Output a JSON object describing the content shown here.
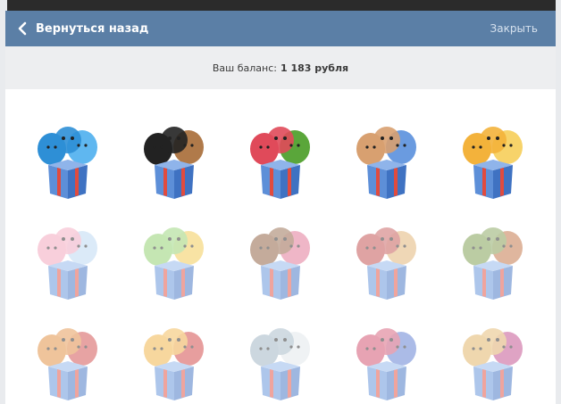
{
  "header": {
    "back_label": "Вернуться назад",
    "close_label": "Закрыть",
    "bg_color": "#5b7fa6"
  },
  "balance": {
    "label": "Ваш баланс:",
    "value": "1 183 рубля"
  },
  "packs": [
    {
      "icon": "blue-dragons-sticker-pack",
      "colors": [
        "#2e8fd6",
        "#5fb7f0"
      ]
    },
    {
      "icon": "rock-band-sticker-pack",
      "colors": [
        "#222222",
        "#b07a4a"
      ]
    },
    {
      "icon": "food-characters-sticker-pack",
      "colors": [
        "#e04a5a",
        "#5aa63a"
      ]
    },
    {
      "icon": "people-thumbs-up-sticker-pack",
      "colors": [
        "#d8a070",
        "#6a9be0"
      ]
    },
    {
      "icon": "sun-star-sticker-pack",
      "colors": [
        "#f3b23b",
        "#f7d36a"
      ]
    },
    {
      "icon": "animals-rainbow-sticker-pack",
      "colors": [
        "#f3a0b8",
        "#b9d6f2"
      ]
    },
    {
      "icon": "cats-collage-sticker-pack",
      "colors": [
        "#8ccf6a",
        "#f2c94c"
      ]
    },
    {
      "icon": "girls-sticker-pack",
      "colors": [
        "#8a5a3a",
        "#e07090"
      ]
    },
    {
      "icon": "mixed-characters-sticker-pack",
      "colors": [
        "#c04a4a",
        "#e0b070"
      ]
    },
    {
      "icon": "kids-goggles-sticker-pack",
      "colors": [
        "#7a9a4a",
        "#c07040"
      ]
    },
    {
      "icon": "cartoon-girl-sticker-pack",
      "colors": [
        "#e08a3a",
        "#d04a4a"
      ]
    },
    {
      "icon": "dog-cat-sticker-pack",
      "colors": [
        "#f0b040",
        "#d04040"
      ]
    },
    {
      "icon": "white-cats-sticker-pack",
      "colors": [
        "#9ab0c0",
        "#e0e6ea"
      ]
    },
    {
      "icon": "couple-hearts-sticker-pack",
      "colors": [
        "#d04a6a",
        "#5a7ad0"
      ]
    },
    {
      "icon": "faces-sticker-pack",
      "colors": [
        "#e0b060",
        "#c04a8a"
      ]
    }
  ],
  "box_colors": {
    "front": "#5d8fd8",
    "side": "#3f72c2",
    "ribbon": "#e14b3e"
  }
}
